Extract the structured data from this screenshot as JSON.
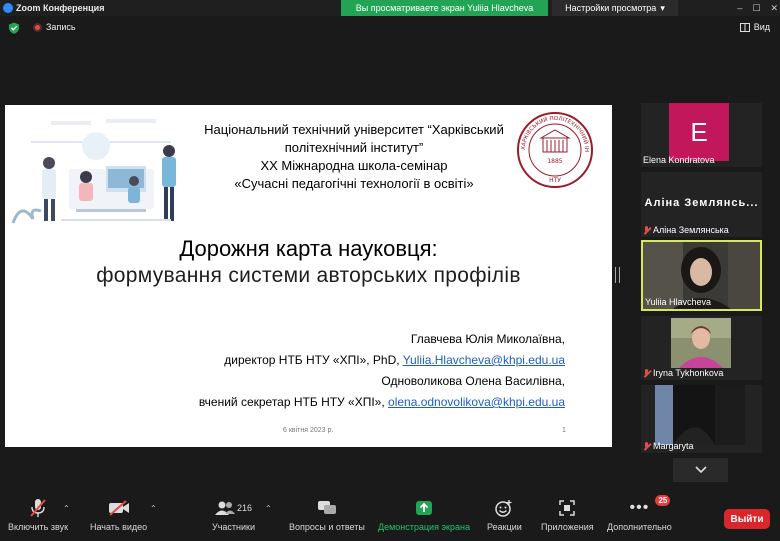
{
  "window": {
    "title": "Zoom Конференция",
    "viewing_banner": "Вы просматриваете экран Yuliia Hlavcheva",
    "view_settings": "Настройки просмотра"
  },
  "topbar": {
    "record_label": "Запись",
    "view_label": "Вид"
  },
  "slide": {
    "university_lines": [
      "Національний технічний університет “Харківський",
      "політехнічний інститут”",
      "XX Міжнародна школа-семінар",
      "«Сучасні педагогічні технології в освіті»"
    ],
    "seal_text": "ХАРКІВСЬКИЙ ПОЛІТЕХНІЧНИЙ ІНСТИТУТ",
    "seal_year": "1885",
    "seal_abbr": "НТУ",
    "title": "Дорожня карта науковця:",
    "subtitle": "формування системи авторських профілів",
    "author1_name": "Главчева Юлія Миколаївна,",
    "author1_role": "директор НТБ НТУ «ХПІ», PhD,",
    "author1_email": "Yuliia.Hlavcheva@khpi.edu.ua",
    "author2_name": "Одноволикова Олена Василівна,",
    "author2_role": "вчений секретар НТБ НТУ «ХПІ»,",
    "author2_email": "olena.odnovolikova@khpi.edu.ua",
    "date": "6 квітня 2023 р.",
    "page_number": "1"
  },
  "participants": [
    {
      "name": "Elena Kondratova",
      "avatar_letter": "E",
      "muted": false
    },
    {
      "name": "Аліна Землянська",
      "display_label": "Аліна Землянсь...",
      "muted": true
    },
    {
      "name": "Yuliia Hlavcheva",
      "muted": false,
      "active_speaker": true
    },
    {
      "name": "Iryna Tykhonkova",
      "muted": true
    },
    {
      "name": "Margaryta",
      "muted": true
    }
  ],
  "toolbar": {
    "unmute": "Включить звук",
    "start_video": "Начать видео",
    "participants": "Участники",
    "participants_count": "216",
    "qa": "Вопросы и ответы",
    "share": "Демонстрация экрана",
    "reactions": "Реакции",
    "apps": "Приложения",
    "more": "Дополнительно",
    "more_badge": "25",
    "leave": "Выйти"
  },
  "colors": {
    "share_green": "#23a455",
    "leave_red": "#d9262b",
    "active_speaker_border": "#d7e85a",
    "avatar_e": "#c2185b",
    "seal_red": "#9b1c2c"
  }
}
